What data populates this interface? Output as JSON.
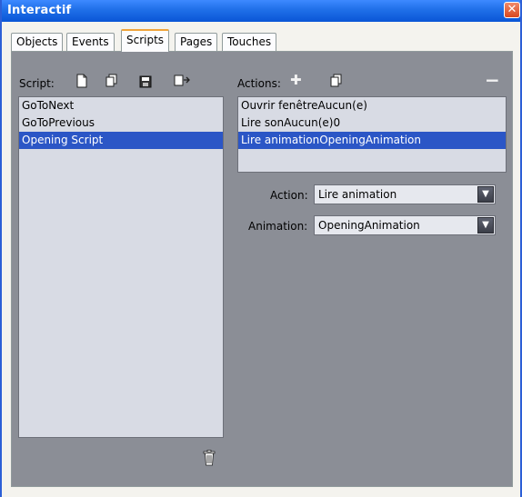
{
  "window": {
    "title": "Interactif",
    "close_glyph": "✕"
  },
  "tabs": [
    {
      "label": "Objects"
    },
    {
      "label": "Events"
    },
    {
      "label": "Scripts"
    },
    {
      "label": "Pages"
    },
    {
      "label": "Touches"
    }
  ],
  "active_tab": "Scripts",
  "script_panel": {
    "label": "Script:",
    "toolbar_icons": [
      "new-script-icon",
      "duplicate-script-icon",
      "save-script-icon",
      "import-script-icon"
    ],
    "items": [
      "GoToNext",
      "GoToPrevious",
      "Opening Script"
    ],
    "selected": "Opening Script",
    "delete_icon": "trash-icon"
  },
  "actions_panel": {
    "label": "Actions:",
    "add_glyph": "✚",
    "remove_glyph": "−",
    "items": [
      "Ouvrir fenêtreAucun(e)",
      "Lire sonAucun(e)0",
      "Lire animationOpeningAnimation"
    ],
    "selected": "Lire animationOpeningAnimation"
  },
  "fields": {
    "action_label": "Action:",
    "action_value": "Lire animation",
    "animation_label": "Animation:",
    "animation_value": "OpeningAnimation",
    "dropdown_glyph": "▼"
  },
  "colors": {
    "titlebar": "#0a55d6",
    "panel_bg": "#8b8e96",
    "list_bg": "#d8dbe4",
    "selection": "#2b56c6"
  }
}
